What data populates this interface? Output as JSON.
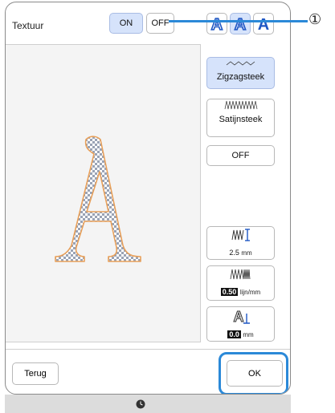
{
  "texture": {
    "label": "Textuur",
    "on_label": "ON",
    "off_label": "OFF"
  },
  "font_buttons": [
    {
      "glyph": "A",
      "icon": "letter-a-outline-icon"
    },
    {
      "glyph": "A",
      "icon": "letter-a-double-outline-icon"
    },
    {
      "glyph": "A",
      "icon": "letter-a-solid-icon"
    }
  ],
  "stitch_types": {
    "zigzag": "Zigzagsteek",
    "satin": "Satijnsteek",
    "off": "OFF"
  },
  "settings": {
    "width_value": "2.5",
    "width_unit": "mm",
    "density_value": "0.50",
    "density_unit": "lijn/mm",
    "offset_value": "0.0",
    "offset_unit": "mm"
  },
  "footer": {
    "back_label": "Terug",
    "ok_label": "OK"
  },
  "callout": {
    "number": "①"
  },
  "colors": {
    "accent_blue": "#2b89d8",
    "selected_fill": "#d6e3fb",
    "letter_outline": "#e8a05a"
  },
  "preview_letter": "A"
}
